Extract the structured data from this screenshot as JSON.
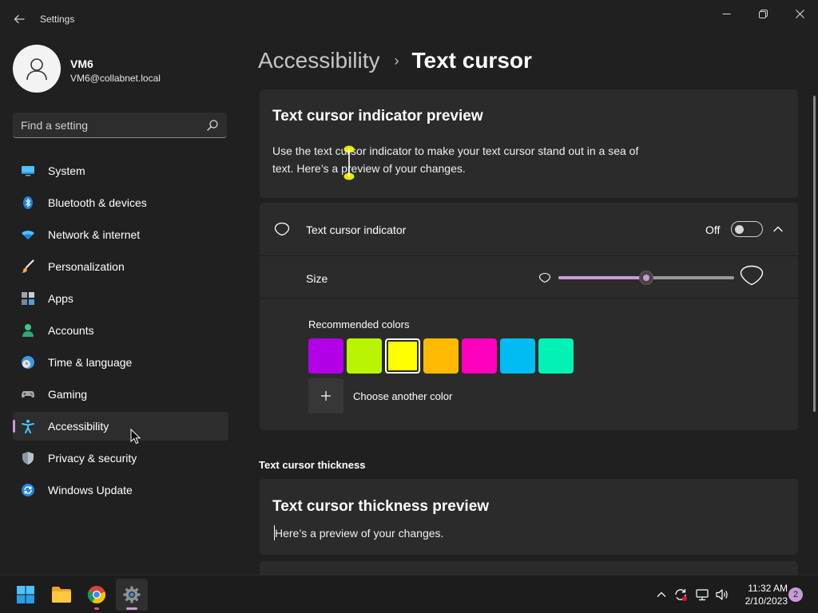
{
  "window": {
    "title": "Settings",
    "back_icon": "back-arrow-icon",
    "controls": [
      "minimize-icon",
      "restore-icon",
      "close-icon"
    ]
  },
  "profile": {
    "name": "VM6",
    "email": "VM6@collabnet.local"
  },
  "search": {
    "placeholder": "Find a setting"
  },
  "sidebar": {
    "items": [
      {
        "label": "System",
        "icon": "monitor-icon"
      },
      {
        "label": "Bluetooth & devices",
        "icon": "bluetooth-icon"
      },
      {
        "label": "Network & internet",
        "icon": "wifi-icon"
      },
      {
        "label": "Personalization",
        "icon": "brush-icon"
      },
      {
        "label": "Apps",
        "icon": "apps-icon"
      },
      {
        "label": "Accounts",
        "icon": "person-icon"
      },
      {
        "label": "Time & language",
        "icon": "globe-clock-icon"
      },
      {
        "label": "Gaming",
        "icon": "gamepad-icon"
      },
      {
        "label": "Accessibility",
        "icon": "accessibility-icon",
        "active": true
      },
      {
        "label": "Privacy & security",
        "icon": "shield-icon"
      },
      {
        "label": "Windows Update",
        "icon": "update-icon"
      }
    ]
  },
  "breadcrumb": {
    "parent": "Accessibility",
    "separator": "›",
    "current": "Text cursor"
  },
  "preview_card": {
    "title": "Text cursor indicator preview",
    "text": "Use the text cursor indicator to make your text cursor stand out in a sea of text. Here’s a preview of your changes."
  },
  "indicator": {
    "label": "Text cursor indicator",
    "state_label": "Off",
    "toggle_on": false,
    "expanded": true,
    "size_label": "Size",
    "size_value_fraction": 0.5,
    "colors_label": "Recommended colors",
    "colors": [
      "#b100e8",
      "#b9f500",
      "#ffff00",
      "#ffb900",
      "#ff00bf",
      "#00bcf2",
      "#00f2b4"
    ],
    "selected_color_index": 2,
    "accent_color": "#c99ad8",
    "choose_color_label": "Choose another color"
  },
  "thickness": {
    "section_heading": "Text cursor thickness",
    "card_title": "Text cursor thickness preview",
    "preview_text": "Here’s a preview of your changes."
  },
  "taskbar": {
    "apps": [
      {
        "name": "start-icon"
      },
      {
        "name": "file-explorer-icon"
      },
      {
        "name": "chrome-icon"
      },
      {
        "name": "settings-gear-icon"
      }
    ],
    "tray_icons": [
      "chevron-up-icon",
      "sync-icon",
      "network-icon",
      "volume-icon"
    ],
    "time": "11:32 AM",
    "date": "2/10/2023",
    "notification_count": "2"
  }
}
